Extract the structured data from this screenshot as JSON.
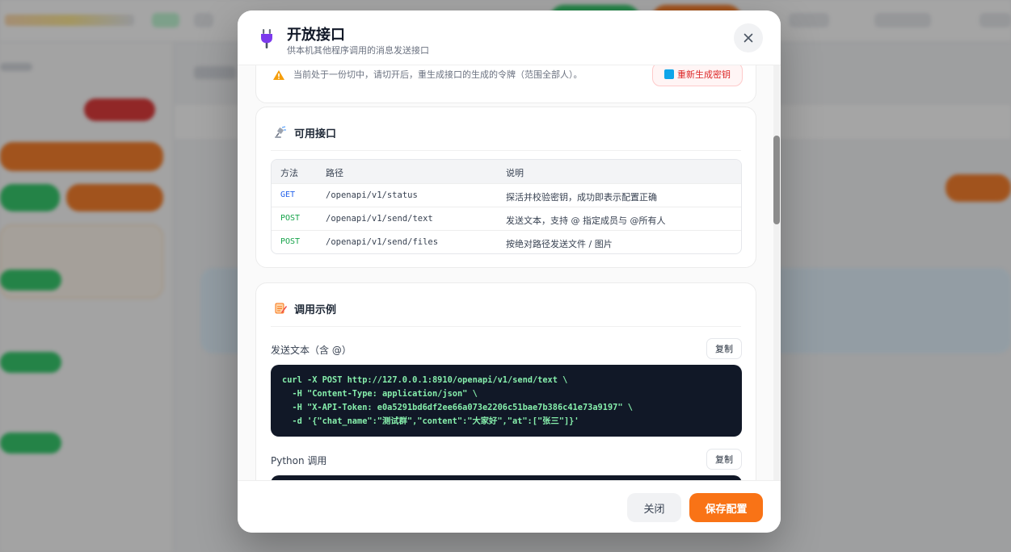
{
  "modal": {
    "title": "开放接口",
    "subtitle": "供本机其他程序调用的消息发送接口",
    "close_icon": "close-icon",
    "plug_icon": "plug-icon"
  },
  "warning": {
    "text": "当前处于一份切中，请切开后，重生成接口的生成的令牌（范围全部人）。",
    "regenerate_label": "重新生成密钥"
  },
  "api_section": {
    "title": "可用接口",
    "columns": [
      "方法",
      "路径",
      "说明"
    ],
    "rows": [
      {
        "method": "GET",
        "path": "/openapi/v1/status",
        "desc": "探活并校验密钥，成功即表示配置正确"
      },
      {
        "method": "POST",
        "path": "/openapi/v1/send/text",
        "desc": "发送文本，支持 @ 指定成员与 @所有人"
      },
      {
        "method": "POST",
        "path": "/openapi/v1/send/files",
        "desc": "按绝对路径发送文件 / 图片"
      }
    ]
  },
  "examples": {
    "title": "调用示例",
    "copy_label": "复制",
    "text_example": {
      "label": "发送文本（含 @）",
      "lines": [
        "curl -X POST http://127.0.0.1:8910/openapi/v1/send/text \\",
        "  -H \"Content-Type: application/json\" \\",
        "  -H \"X-API-Token: e0a5291bd6df2ee66a073e2206c51bae7b386c41e73a9197\" \\",
        "  -d '{\"chat_name\":\"测试群\",\"content\":\"大家好\",\"at\":[\"张三\"]}'"
      ]
    },
    "python_example": {
      "label": "Python 调用"
    }
  },
  "footer": {
    "close_label": "关闭",
    "save_label": "保存配置"
  },
  "colors": {
    "accent": "#f97316",
    "get": "#2563eb",
    "post": "#16a34a",
    "code_bg": "#111827",
    "code_text": "#86efac"
  }
}
